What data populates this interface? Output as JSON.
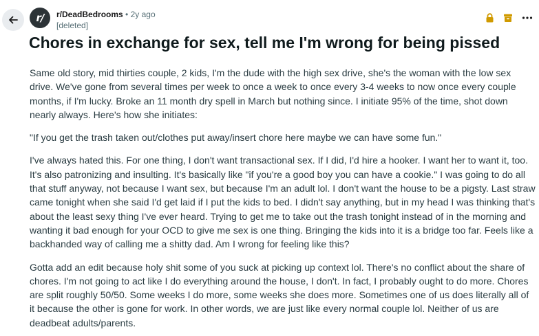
{
  "header": {
    "subreddit": "r/DeadBedrooms",
    "separator": "•",
    "age": "2y ago",
    "author": "[deleted]",
    "avatar_glyph": "r/"
  },
  "icons": {
    "back": "arrow-left-icon",
    "lock": "lock-icon",
    "archive": "archive-icon",
    "more": "more-options-icon"
  },
  "colors": {
    "lock_archive": "#d09a00",
    "avatar_bg": "#2c3337",
    "back_bg": "#e9ecef"
  },
  "post": {
    "title": "Chores in exchange for sex, tell me I'm wrong for being pissed",
    "paragraphs": [
      "Same old story, mid thirties couple, 2 kids, I'm the dude with the high sex drive, she's the woman with the low sex drive. We've gone from several times per week to once a week to once every 3-4 weeks to now once every couple months, if I'm lucky. Broke an 11 month dry spell in March but nothing since. I initiate 95% of the time, shot down nearly always. Here's how she initiates:",
      "\"If you get the trash taken out/clothes put away/insert chore here maybe we can have some fun.\"",
      "I've always hated this. For one thing, I don't want transactional sex. If I did, I'd hire a hooker. I want her to want it, too. It's also patronizing and insulting. It's basically like \"if you're a good boy you can have a cookie.\" I was going to do all that stuff anyway, not because I want sex, but because I'm an adult lol. I don't want the house to be a pigsty. Last straw came tonight when she said I'd get laid if I put the kids to bed. I didn't say anything, but in my head I was thinking that's about the least sexy thing I've ever heard. Trying to get me to take out the trash tonight instead of in the morning and wanting it bad enough for your OCD to give me sex is one thing. Bringing the kids into it is a bridge too far. Feels like a backhanded way of calling me a shitty dad. Am I wrong for feeling like this?",
      "Gotta add an edit because holy shit some of you suck at picking up context lol. There's no conflict about the share of chores. I'm not going to act like I do everything around the house, I don't. In fact, I probably ought to do more. Chores are split roughly 50/50. Some weeks I do more, some weeks she does more. Sometimes one of us does literally all of it because the other is gone for work. In other words, we are just like every normal couple lol. Neither of us are deadbeat adults/parents."
    ]
  }
}
